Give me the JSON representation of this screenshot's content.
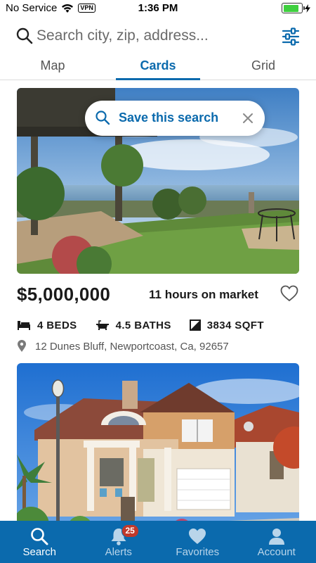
{
  "status_bar": {
    "carrier": "No Service",
    "vpn": "VPN",
    "time": "1:36 PM",
    "battery_level": 0.85
  },
  "search": {
    "placeholder": "Search city, zip, address...",
    "icon": "search-icon",
    "filter_icon": "filter-sliders-icon"
  },
  "tabs": [
    {
      "label": "Map",
      "active": false
    },
    {
      "label": "Cards",
      "active": true
    },
    {
      "label": "Grid",
      "active": false
    }
  ],
  "save_search": {
    "label": "Save this search",
    "close_icon": "close-icon"
  },
  "listings": [
    {
      "price": "$5,000,000",
      "market_time": "11 hours on market",
      "beds": "4 BEDS",
      "baths": "4.5 BATHS",
      "sqft": "3834 SQFT",
      "address": "12 Dunes Bluff, Newportcoast, Ca, 92657"
    },
    {
      "price": "",
      "market_time": "",
      "beds": "",
      "baths": "",
      "sqft": "",
      "address": ""
    }
  ],
  "bottom_nav": [
    {
      "label": "Search",
      "icon": "search-icon",
      "active": true
    },
    {
      "label": "Alerts",
      "icon": "bell-icon",
      "active": false,
      "badge": "25"
    },
    {
      "label": "Favorites",
      "icon": "heart-icon",
      "active": false
    },
    {
      "label": "Account",
      "icon": "person-icon",
      "active": false
    }
  ],
  "colors": {
    "accent": "#0b6aad",
    "badge": "#c0392b",
    "battery": "#3ecf3e"
  }
}
